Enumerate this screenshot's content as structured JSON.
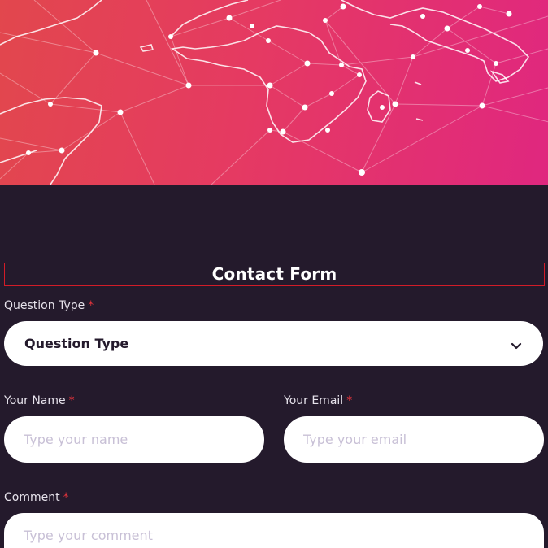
{
  "form": {
    "title": "Contact Form",
    "question_type": {
      "label": "Question Type",
      "required_mark": "*",
      "selected_value": "Question Type"
    },
    "name": {
      "label": "Your Name",
      "required_mark": "*",
      "placeholder": "Type your name"
    },
    "email": {
      "label": "Your Email",
      "required_mark": "*",
      "placeholder": "Type your email"
    },
    "comment": {
      "label": "Comment",
      "required_mark": "*",
      "placeholder": "Type your comment"
    }
  },
  "colors": {
    "page_background": "#241a2c",
    "hero_gradient_start": "#e2474d",
    "hero_gradient_end": "#e0277f",
    "required_mark": "#e5343c",
    "title_border": "#d21c28"
  },
  "icons": {
    "select_chevron": "chevron-down-icon"
  }
}
